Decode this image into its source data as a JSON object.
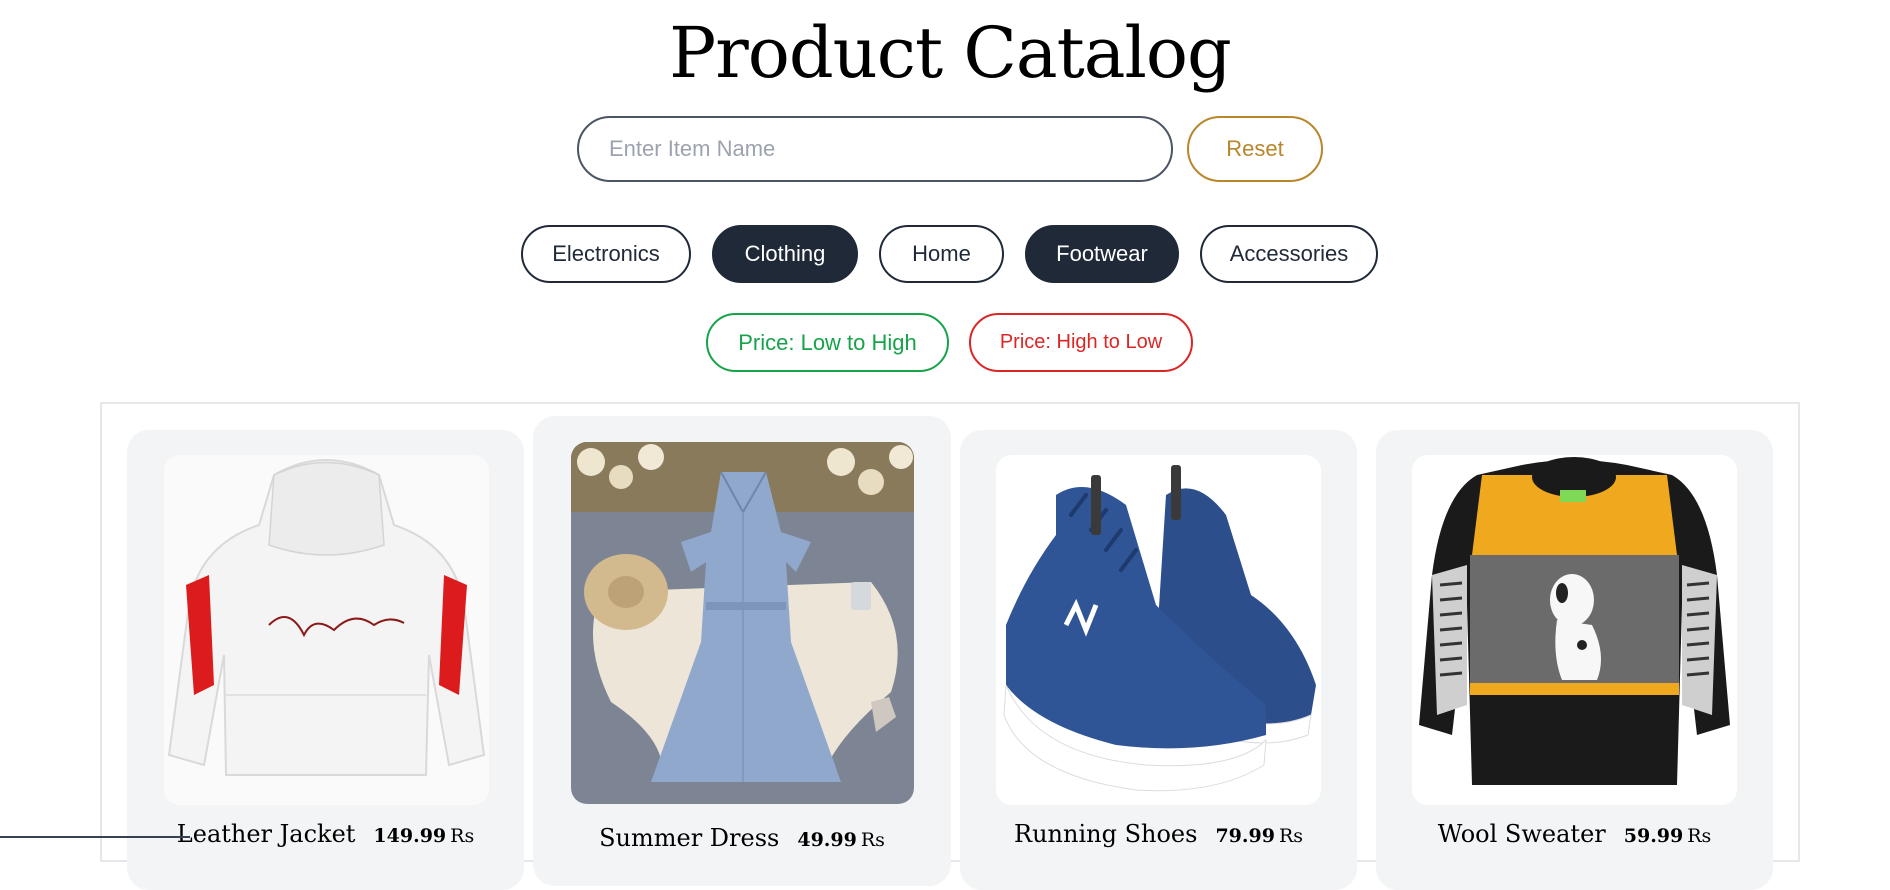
{
  "page_title": "Product Catalog",
  "search": {
    "placeholder": "Enter Item Name",
    "value": ""
  },
  "reset_label": "Reset",
  "categories": [
    {
      "label": "Electronics",
      "active": false
    },
    {
      "label": "Clothing",
      "active": true
    },
    {
      "label": "Home",
      "active": false
    },
    {
      "label": "Footwear",
      "active": true
    },
    {
      "label": "Accessories",
      "active": false
    }
  ],
  "sort": {
    "low_to_high": "Price: Low to High",
    "high_to_low": "Price: High to Low"
  },
  "products": [
    {
      "name": "Leather Jacket",
      "price": "149.99",
      "currency": "Rs",
      "icon": "jacket-image"
    },
    {
      "name": "Summer Dress",
      "price": "49.99",
      "currency": "Rs",
      "icon": "dress-image"
    },
    {
      "name": "Running Shoes",
      "price": "79.99",
      "currency": "Rs",
      "icon": "shoes-image"
    },
    {
      "name": "Wool Sweater",
      "price": "59.99",
      "currency": "Rs",
      "icon": "sweater-image"
    }
  ],
  "colors": {
    "accent_dark": "#1f2937",
    "reset": "#b8862b",
    "sort_low": "#16a34a",
    "sort_high": "#dc2626",
    "card_bg": "#f3f4f6"
  }
}
